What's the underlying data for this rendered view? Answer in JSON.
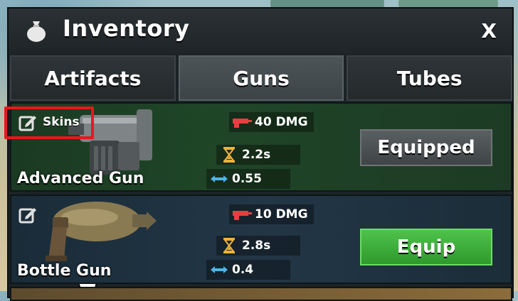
{
  "header": {
    "title": "Inventory",
    "close_label": "X",
    "icon": "bag-icon"
  },
  "tabs": [
    {
      "label": "Artifacts",
      "active": false
    },
    {
      "label": "Guns",
      "active": true
    },
    {
      "label": "Tubes",
      "active": false
    }
  ],
  "guns": [
    {
      "name": "Advanced Gun",
      "skins_label": "Skins",
      "damage": "40 DMG",
      "cooldown": "2.2s",
      "range": "0.55",
      "action_label": "Equipped",
      "equipped": true
    },
    {
      "name": "Bottle Gun",
      "damage": "10 DMG",
      "cooldown": "2.8s",
      "range": "0.4",
      "action_label": "Equip",
      "equipped": false
    }
  ],
  "colors": {
    "equip_green": "#3fb03c",
    "equipped_gray": "#4b5053",
    "highlight_red": "#e41a1a"
  }
}
